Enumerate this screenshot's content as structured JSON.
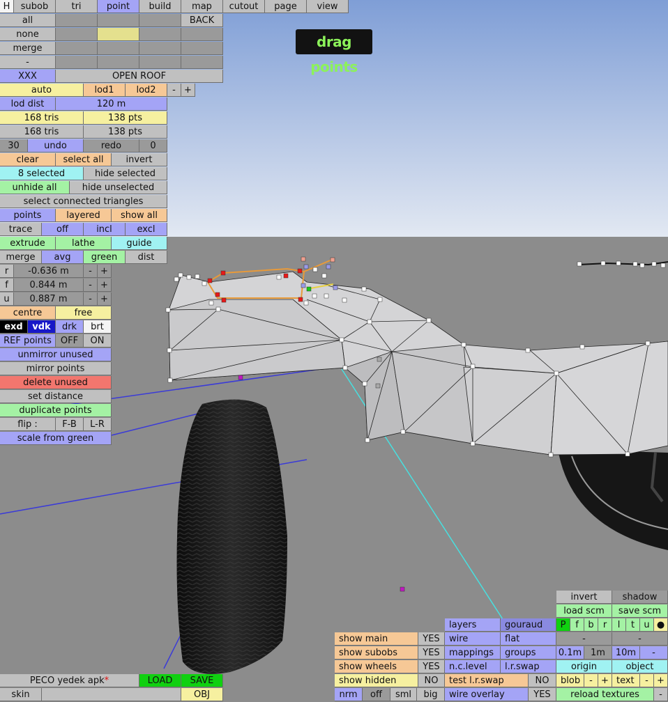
{
  "menu": {
    "h": "H",
    "subob": "subob",
    "tri": "tri",
    "point": "point",
    "build": "build",
    "map": "map",
    "cutout": "cutout",
    "page": "page",
    "view": "view"
  },
  "panel": {
    "all": "all",
    "back": "BACK",
    "none": "none",
    "merge": "merge",
    "dash": "-",
    "xxx": "XXX",
    "open_roof": "OPEN ROOF",
    "auto": "auto",
    "lod1": "lod1",
    "lod2": "lod2",
    "minus": "-",
    "plus": "+",
    "lod_dist_label": "lod dist",
    "lod_dist_value": "120 m",
    "tris1": "168 tris",
    "pts1": "138 pts",
    "tris2": "168 tris",
    "pts2": "138 pts",
    "undo_count": "30",
    "undo": "undo",
    "redo": "redo",
    "redo_count": "0",
    "clear": "clear",
    "select_all": "select all",
    "invert": "invert",
    "selected": "8 selected",
    "hide_selected": "hide selected",
    "unhide_all": "unhide all",
    "hide_unselected": "hide unselected",
    "select_connected": "select connected triangles",
    "points": "points",
    "layered": "layered",
    "show_all": "show all",
    "trace": "trace",
    "off": "off",
    "incl": "incl",
    "excl": "excl",
    "extrude": "extrude",
    "lathe": "lathe",
    "guide": "guide",
    "merge2": "merge",
    "avg": "avg",
    "green": "green",
    "dist": "dist",
    "r_label": "r",
    "r_value": "-0.636 m",
    "f_label": "f",
    "f_value": "0.844 m",
    "u_label": "u",
    "u_value": "0.887 m",
    "centre": "centre",
    "free": "free",
    "exd": "exd",
    "vdk": "vdk",
    "drk": "drk",
    "brt": "brt",
    "ref_points": "REF points",
    "ref_off": "OFF",
    "ref_on": "ON",
    "unmirror_unused": "unmirror unused",
    "mirror_points": "mirror points",
    "delete_unused": "delete unused",
    "set_distance": "set distance",
    "duplicate_points": "duplicate points",
    "flip": "flip :",
    "fb": "F-B",
    "lr": "L-R",
    "scale_from_green": "scale from green"
  },
  "mode_badge": "drag points",
  "bottom_left": {
    "filename": "PECO yedek apk",
    "modified_mark": "*",
    "load": "LOAD",
    "save": "SAVE",
    "skin": "skin",
    "obj": "OBJ"
  },
  "bottom_mid": {
    "show_main": "show main",
    "show_main_v": "YES",
    "show_subobs": "show subobs",
    "show_subobs_v": "YES",
    "show_wheels": "show wheels",
    "show_wheels_v": "YES",
    "show_hidden": "show hidden",
    "show_hidden_v": "NO",
    "nrm": "nrm",
    "off": "off",
    "sml": "sml",
    "big": "big",
    "layers": "layers",
    "gouraud": "gouraud",
    "wire": "wire",
    "flat": "flat",
    "mappings": "mappings",
    "groups": "groups",
    "nc_level": "n.c.level",
    "lr_swap": "l.r.swap",
    "test_lr_swap": "test l.r.swap",
    "test_lr_swap_v": "NO",
    "wire_overlay": "wire overlay",
    "wire_overlay_v": "YES"
  },
  "bottom_right": {
    "invert": "invert",
    "shadow": "shadow",
    "load_scm": "load scm",
    "save_scm": "save scm",
    "views": [
      "P",
      "f",
      "b",
      "r",
      "l",
      "t",
      "u",
      "●"
    ],
    "dash1": "-",
    "dash2": "-",
    "s01": "0.1m",
    "s1": "1m",
    "s10": "10m",
    "sdash": "-",
    "origin": "origin",
    "object": "object",
    "blob": "blob",
    "blob_minus": "-",
    "blob_plus": "+",
    "text": "text",
    "text_minus": "-",
    "text_plus": "+",
    "reload_textures": "reload textures",
    "reload_dash": "-"
  },
  "colors": {
    "sky_top": "#7f9ed6",
    "sky_bottom": "#dfe6f2",
    "floor": "#8b8b8b",
    "body": "#d6d6d8",
    "tyre": "#1c1c1c",
    "badge_text": "#8cf25a"
  }
}
